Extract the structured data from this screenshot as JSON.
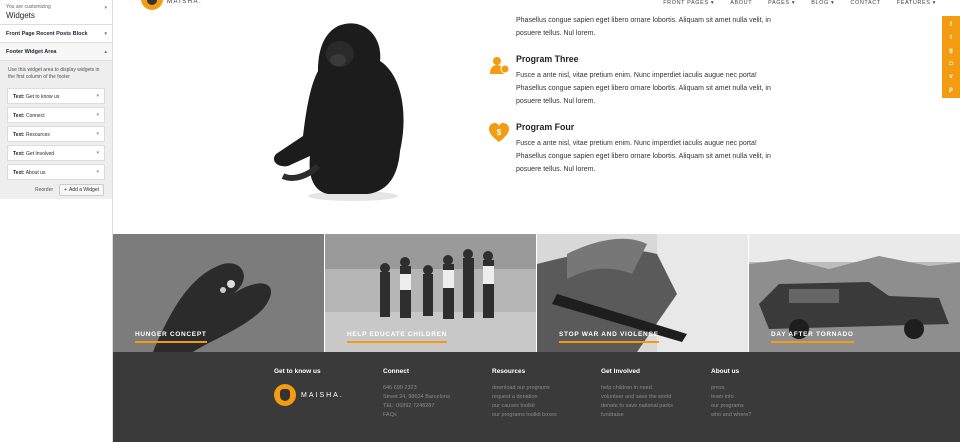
{
  "customizer": {
    "subtitle": "You are customizing",
    "title": "Widgets",
    "sections": [
      {
        "label": "Front Page Recent Posts Block"
      },
      {
        "label": "Footer Widget Area"
      }
    ],
    "description": "Use this widget area to display widgets in the first column of the footer",
    "widgets": [
      {
        "prefix": "Text:",
        "name": "Get to know us"
      },
      {
        "prefix": "Text:",
        "name": "Connect"
      },
      {
        "prefix": "Text:",
        "name": "Resources"
      },
      {
        "prefix": "Text:",
        "name": "Get Involved"
      },
      {
        "prefix": "Text:",
        "name": "About us"
      }
    ],
    "reorder_label": "Reorder",
    "add_widget_label": "Add a Widget"
  },
  "site": {
    "logo_text": "MAISHA.",
    "nav": [
      "FRONT PAGES ▾",
      "ABOUT",
      "PAGES ▾",
      "BLOG ▾",
      "CONTACT",
      "FEATURES ▾"
    ],
    "top_para": "Phasellus congue sapien eget libero ornare lobortis. Aliquam sit amet nulla velit, in posuere tellus. Nul lorem.",
    "programs": [
      {
        "title": "Program Three",
        "text": "Fusce a ante nisl, vitae pretium enim. Nunc imperdiet iaculis augue nec porta! Phasellus congue sapien eget libero ornare lobortis. Aliquam sit amet nulla velit, in posuere tellus. Nul lorem."
      },
      {
        "title": "Program Four",
        "text": "Fusce a ante nisl, vitae pretium enim. Nunc imperdiet iaculis augue nec porta! Phasellus congue sapien eget libero ornare lobortis. Aliquam sit amet nulla velit, in posuere tellus. Nul lorem."
      }
    ],
    "social_icons": [
      "facebook-icon",
      "twitter-icon",
      "google-plus-icon",
      "instagram-icon",
      "vimeo-icon",
      "pinterest-icon"
    ],
    "gallery": [
      {
        "label": "HUNGER CONCEPT"
      },
      {
        "label": "HELP EDUCATE CHILDREN"
      },
      {
        "label": "STOP WAR AND VIOLENCE"
      },
      {
        "label": "DAY AFTER TORNADO"
      }
    ],
    "footer": {
      "col1_title": "Get to know us",
      "col2_title": "Connect",
      "connect_lines": [
        "646 699 2323",
        "Street 24, 98634 Barcelona",
        "TEL: 06892 7248287",
        "FAQs"
      ],
      "col3_title": "Resources",
      "resources_links": [
        "download our programs",
        "request a donation",
        "our causes toolkit",
        "our programs toolkit boxes"
      ],
      "col4_title": "Get Involved",
      "involved_links": [
        "help children in need",
        "volunteer and save the world",
        "donate to save national parks",
        "fundraise"
      ],
      "col5_title": "About us",
      "about_links": [
        "press",
        "team info",
        "our programs",
        "who and where?"
      ]
    },
    "accent_color": "#f39c12"
  }
}
